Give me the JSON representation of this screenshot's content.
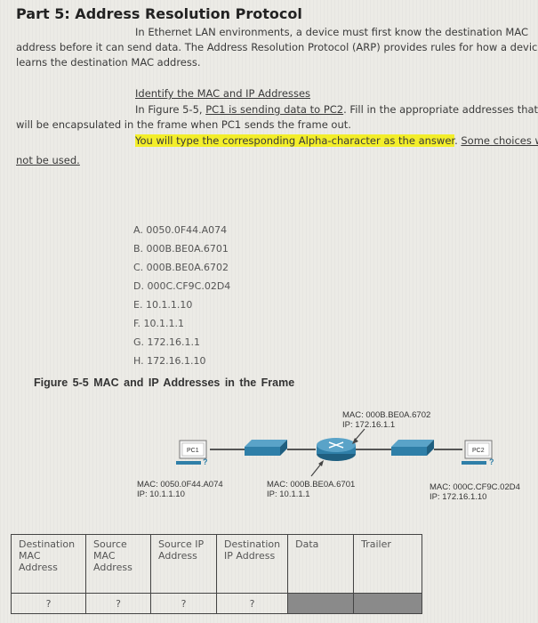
{
  "title": "Part 5: Address Resolution Protocol",
  "intro": {
    "line1": "In Ethernet LAN environments, a device must first know the destination MAC",
    "line2": "address before it can send data. The Address Resolution Protocol (ARP) provides rules for how a device",
    "line3": "learns the destination MAC address."
  },
  "section": {
    "heading": "Identify the MAC and IP Addresses",
    "instr_pre": "In Figure 5-5, ",
    "instr_link": "PC1 is sending data to PC2",
    "instr_post": ". Fill in the appropriate addresses that",
    "instr_line2": "will be encapsulated in the frame when PC1 sends the frame out.",
    "highlight": "You will type the corresponding Alpha-character as the answer",
    "note1": "Some choices wil",
    "note2": "not be used."
  },
  "choices": [
    "A. 0050.0F44.A074",
    "B. 000B.BE0A.6701",
    "C. 000B.BE0A.6702",
    "D. 000C.CF9C.02D4",
    "E. 10.1.1.10",
    "F. 10.1.1.1",
    "G. 172.16.1.1",
    "H. 172.16.1.10"
  ],
  "figure": {
    "title": "Figure 5-5   MAC and IP Addresses in the Frame",
    "pc1": {
      "name": "PC1",
      "mac": "MAC: 0050.0F44.A074",
      "ip": "IP: 10.1.1.10"
    },
    "router_left": {
      "mac": "MAC: 000B.BE0A.6701",
      "ip": "IP: 10.1.1.1"
    },
    "router_right": {
      "mac": "MAC: 000B.BE0A.6702",
      "ip": "IP: 172.16.1.1"
    },
    "pc2": {
      "name": "PC2",
      "mac": "MAC: 000C.CF9C.02D4",
      "ip": "IP: 172.16.1.10"
    }
  },
  "frame_table": {
    "headers": [
      "Destination MAC Address",
      "Source MAC Address",
      "Source IP Address",
      "Destination IP Address",
      "Data",
      "Trailer"
    ],
    "values": [
      "?",
      "?",
      "?",
      "?",
      "",
      ""
    ]
  },
  "colors": {
    "highlight": "#f3ee2a",
    "device_blue": "#2f7fa8"
  }
}
